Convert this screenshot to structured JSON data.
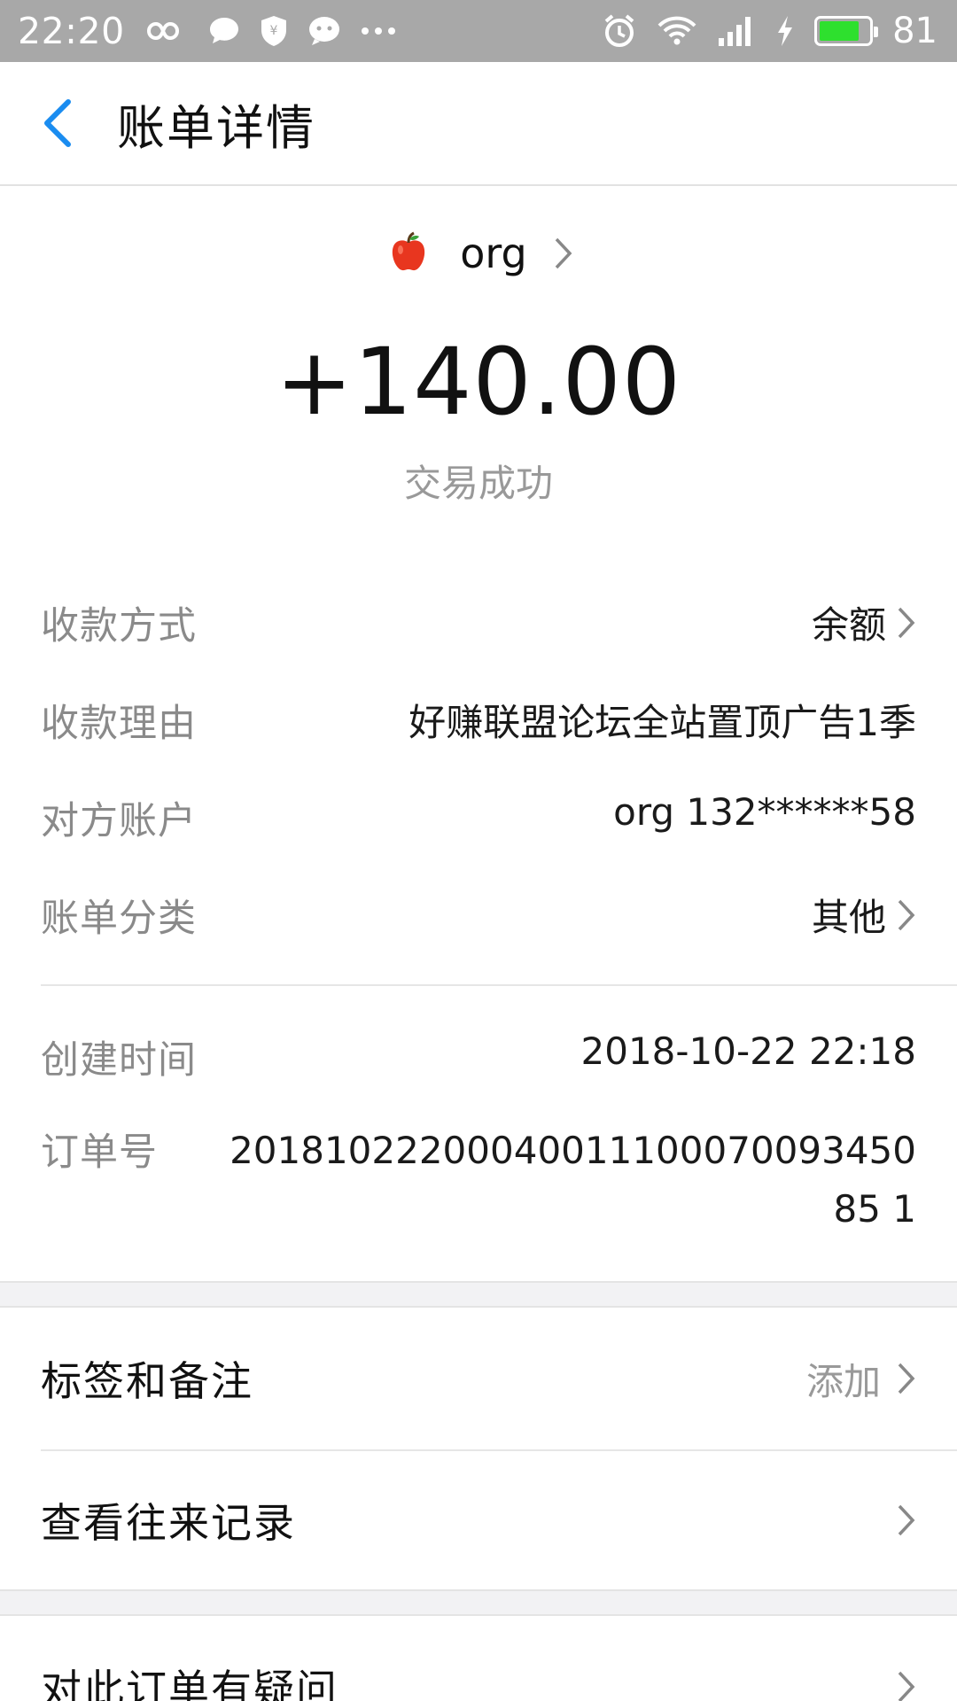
{
  "status_bar": {
    "time": "22:20",
    "battery": "81",
    "battery_level": 0.81,
    "icons_left": [
      "infinity-icon",
      "chat-bubble-icon",
      "shield-yen-icon",
      "message-icon",
      "more-icon"
    ],
    "icons_right": [
      "alarm-icon",
      "wifi-icon",
      "signal-icon",
      "charging-icon",
      "battery-icon"
    ]
  },
  "header": {
    "title": "账单详情"
  },
  "merchant": {
    "name": "org"
  },
  "transaction": {
    "amount": "+140.00",
    "status": "交易成功"
  },
  "details": [
    {
      "label": "收款方式",
      "value": "余额"
    },
    {
      "label": "收款理由",
      "value": "好赚联盟论坛全站置顶广告1季"
    },
    {
      "label": "对方账户",
      "value": "org 132******58"
    },
    {
      "label": "账单分类",
      "value": "其他"
    },
    {
      "label": "创建时间",
      "value": "2018-10-22 22:18"
    },
    {
      "label": "订单号",
      "value": "2018102220004001110007009345085 1"
    }
  ],
  "actions": {
    "tags": {
      "label": "标签和备注",
      "value": "添加"
    },
    "history": {
      "label": "查看往来记录"
    },
    "question": {
      "label": "对此订单有疑问"
    }
  },
  "colors": {
    "accent": "#1a8cf0",
    "status_bar": "#a8a8a8",
    "battery": "#2ee02e"
  }
}
